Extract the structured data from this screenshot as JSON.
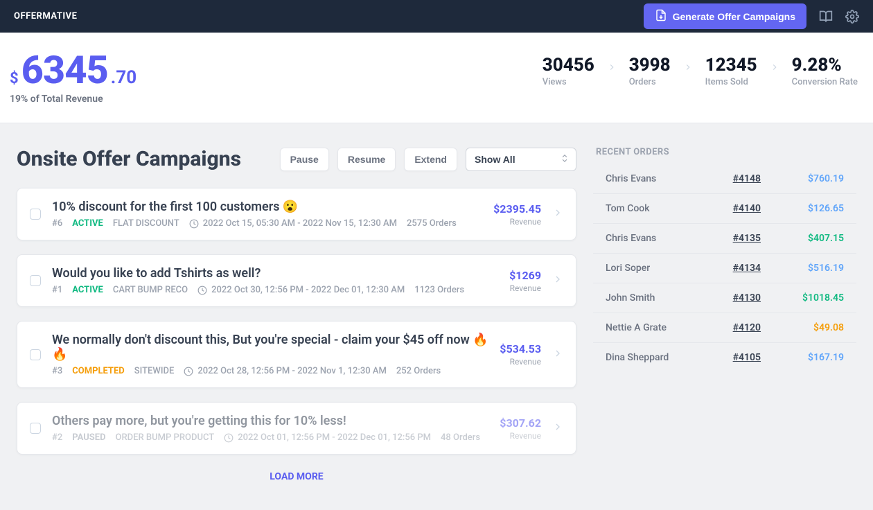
{
  "header": {
    "brand": "OFFERMATIVE",
    "generate_btn": "Generate Offer Campaigns"
  },
  "stats": {
    "currency": "$",
    "revenue_int": "6345",
    "revenue_dec": ".70",
    "revenue_sub": "19% of Total Revenue",
    "items": [
      {
        "value": "30456",
        "label": "Views"
      },
      {
        "value": "3998",
        "label": "Orders"
      },
      {
        "value": "12345",
        "label": "Items Sold"
      },
      {
        "value": "9.28%",
        "label": "Conversion Rate"
      }
    ]
  },
  "page": {
    "title": "Onsite Offer Campaigns",
    "pause": "Pause",
    "resume": "Resume",
    "extend": "Extend",
    "show_all": "Show All",
    "load_more": "LOAD MORE"
  },
  "campaigns": [
    {
      "title": "10% discount for the first 100 customers 😮",
      "num": "#6",
      "status": "ACTIVE",
      "status_class": "status-active",
      "type": "FLAT DISCOUNT",
      "dates": "2022 Oct 15, 05:30 AM - 2022 Nov 15, 12:30 AM",
      "orders": "2575 Orders",
      "revenue": "$2395.45",
      "rev_label": "Revenue",
      "paused": false
    },
    {
      "title": "Would you like to add Tshirts as well?",
      "num": "#1",
      "status": "ACTIVE",
      "status_class": "status-active",
      "type": "CART BUMP RECO",
      "dates": "2022 Oct 30, 12:56 PM - 2022 Dec 01, 12:30 AM",
      "orders": "1123 Orders",
      "revenue": "$1269",
      "rev_label": "Revenue",
      "paused": false
    },
    {
      "title": "We normally don't discount this, But you're special - claim your $45 off now 🔥🔥",
      "num": "#3",
      "status": "COMPLETED",
      "status_class": "status-completed",
      "type": "SITEWIDE",
      "dates": "2022 Oct 28, 12:56 PM - 2022 Nov 1, 12:30 AM",
      "orders": "252 Orders",
      "revenue": "$534.53",
      "rev_label": "Revenue",
      "paused": false
    },
    {
      "title": "Others pay more, but you're getting this for 10% less!",
      "num": "#2",
      "status": "PAUSED",
      "status_class": "status-paused",
      "type": "ORDER BUMP PRODUCT",
      "dates": "2022 Oct 01, 12:56 PM - 2022 Dec 01, 12:56 PM",
      "orders": "48 Orders",
      "revenue": "$307.62",
      "rev_label": "Revenue",
      "paused": true
    }
  ],
  "recent_orders": {
    "title": "RECENT ORDERS",
    "rows": [
      {
        "name": "Chris Evans",
        "id": "#4148",
        "amount": "$760.19",
        "class": "amt-blue"
      },
      {
        "name": "Tom Cook",
        "id": "#4140",
        "amount": "$126.65",
        "class": "amt-blue"
      },
      {
        "name": "Chris Evans",
        "id": "#4135",
        "amount": "$407.15",
        "class": "amt-green"
      },
      {
        "name": "Lori Soper",
        "id": "#4134",
        "amount": "$516.19",
        "class": "amt-blue"
      },
      {
        "name": "John Smith",
        "id": "#4130",
        "amount": "$1018.45",
        "class": "amt-green"
      },
      {
        "name": "Nettie A Grate",
        "id": "#4120",
        "amount": "$49.08",
        "class": "amt-orange"
      },
      {
        "name": "Dina Sheppard",
        "id": "#4105",
        "amount": "$167.19",
        "class": "amt-blue"
      }
    ]
  }
}
